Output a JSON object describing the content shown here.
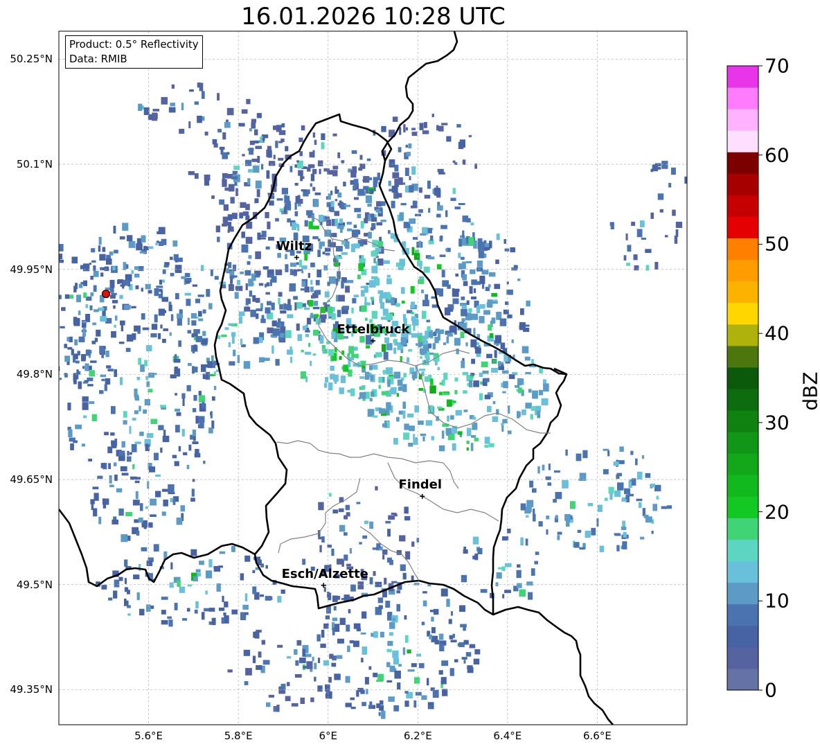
{
  "title": "16.01.2026 10:28 UTC",
  "info_box": {
    "product": "Product: 0.5° Reflectivity",
    "data": "Data: RMIB"
  },
  "map": {
    "lat_range": [
      49.3,
      50.29
    ],
    "lon_range": [
      5.4,
      6.8
    ],
    "lat_ticks": [
      {
        "value": 50.25,
        "label": "50.25°N"
      },
      {
        "value": 50.1,
        "label": "50.1°N"
      },
      {
        "value": 49.95,
        "label": "49.95°N"
      },
      {
        "value": 49.8,
        "label": "49.8°N"
      },
      {
        "value": 49.65,
        "label": "49.65°N"
      },
      {
        "value": 49.5,
        "label": "49.5°N"
      },
      {
        "value": 49.35,
        "label": "49.35°N"
      }
    ],
    "lon_ticks": [
      {
        "value": 5.6,
        "label": "5.6°E"
      },
      {
        "value": 5.8,
        "label": "5.8°E"
      },
      {
        "value": 6.0,
        "label": "6°E"
      },
      {
        "value": 6.2,
        "label": "6.2°E"
      },
      {
        "value": 6.4,
        "label": "6.4°E"
      },
      {
        "value": 6.6,
        "label": "6.6°E"
      }
    ],
    "cities": [
      {
        "name": "Wiltz",
        "lon": 5.93,
        "lat": 49.967
      },
      {
        "name": "Ettelbruck",
        "lon": 6.1,
        "lat": 49.848
      },
      {
        "name": "Findel",
        "lon": 6.21,
        "lat": 49.626
      },
      {
        "name": "Esch/Alzette",
        "lon": 5.99,
        "lat": 49.499
      }
    ],
    "radar_site": {
      "lon": 5.505,
      "lat": 49.915
    },
    "grid": true,
    "border_color": "#000000",
    "canton_border_color": "#808080"
  },
  "colorbar": {
    "unit": "dBZ",
    "min": 0,
    "max": 70,
    "tick_labels": [
      "0",
      "10",
      "20",
      "30",
      "40",
      "50",
      "60",
      "70"
    ],
    "colors": [
      "#6472a6",
      "#5563a0",
      "#4763a3",
      "#4a73b0",
      "#5b9bc6",
      "#69c0da",
      "#5cd6c0",
      "#41d477",
      "#13c823",
      "#12b91e",
      "#12a81a",
      "#119617",
      "#0f8212",
      "#0c6c0f",
      "#0b5a0c",
      "#4d760c",
      "#afb20a",
      "#ffd600",
      "#fbb300",
      "#fe9c00",
      "#ff7f00",
      "#e40000",
      "#c60000",
      "#a60000",
      "#7c0000",
      "#ffdfff",
      "#ffb2ff",
      "#ff7cff",
      "#e935e9"
    ]
  }
}
